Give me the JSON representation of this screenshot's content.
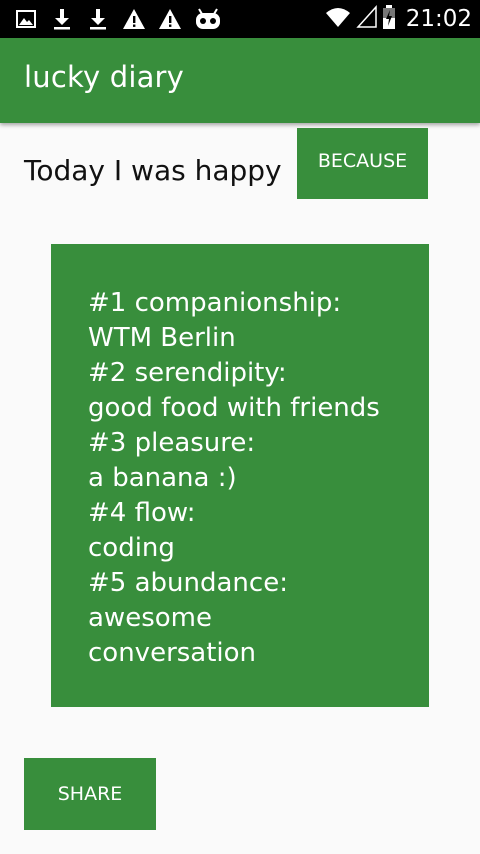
{
  "status_bar": {
    "time": "21:02",
    "left_icons": [
      "image-icon",
      "download-icon",
      "download-icon",
      "warning-icon",
      "warning-icon",
      "android-icon"
    ],
    "right_icons": [
      "wifi-icon",
      "signal-icon",
      "battery-icon"
    ]
  },
  "app_bar": {
    "title": "lucky diary",
    "color": "#388e3c"
  },
  "main": {
    "happy_label": "Today I was happy",
    "because_label": "BECAUSE",
    "entries": [
      "#1 companionship:",
      "WTM Berlin",
      "#2 serendipity:",
      "good food with friends",
      "#3 pleasure:",
      "a banana :)",
      "#4 flow:",
      "coding",
      "#5 abundance:",
      "awesome",
      "conversation"
    ],
    "share_label": "SHARE"
  },
  "colors": {
    "accent": "#388e3c",
    "background": "#fafafa",
    "status_bar": "#000000"
  }
}
